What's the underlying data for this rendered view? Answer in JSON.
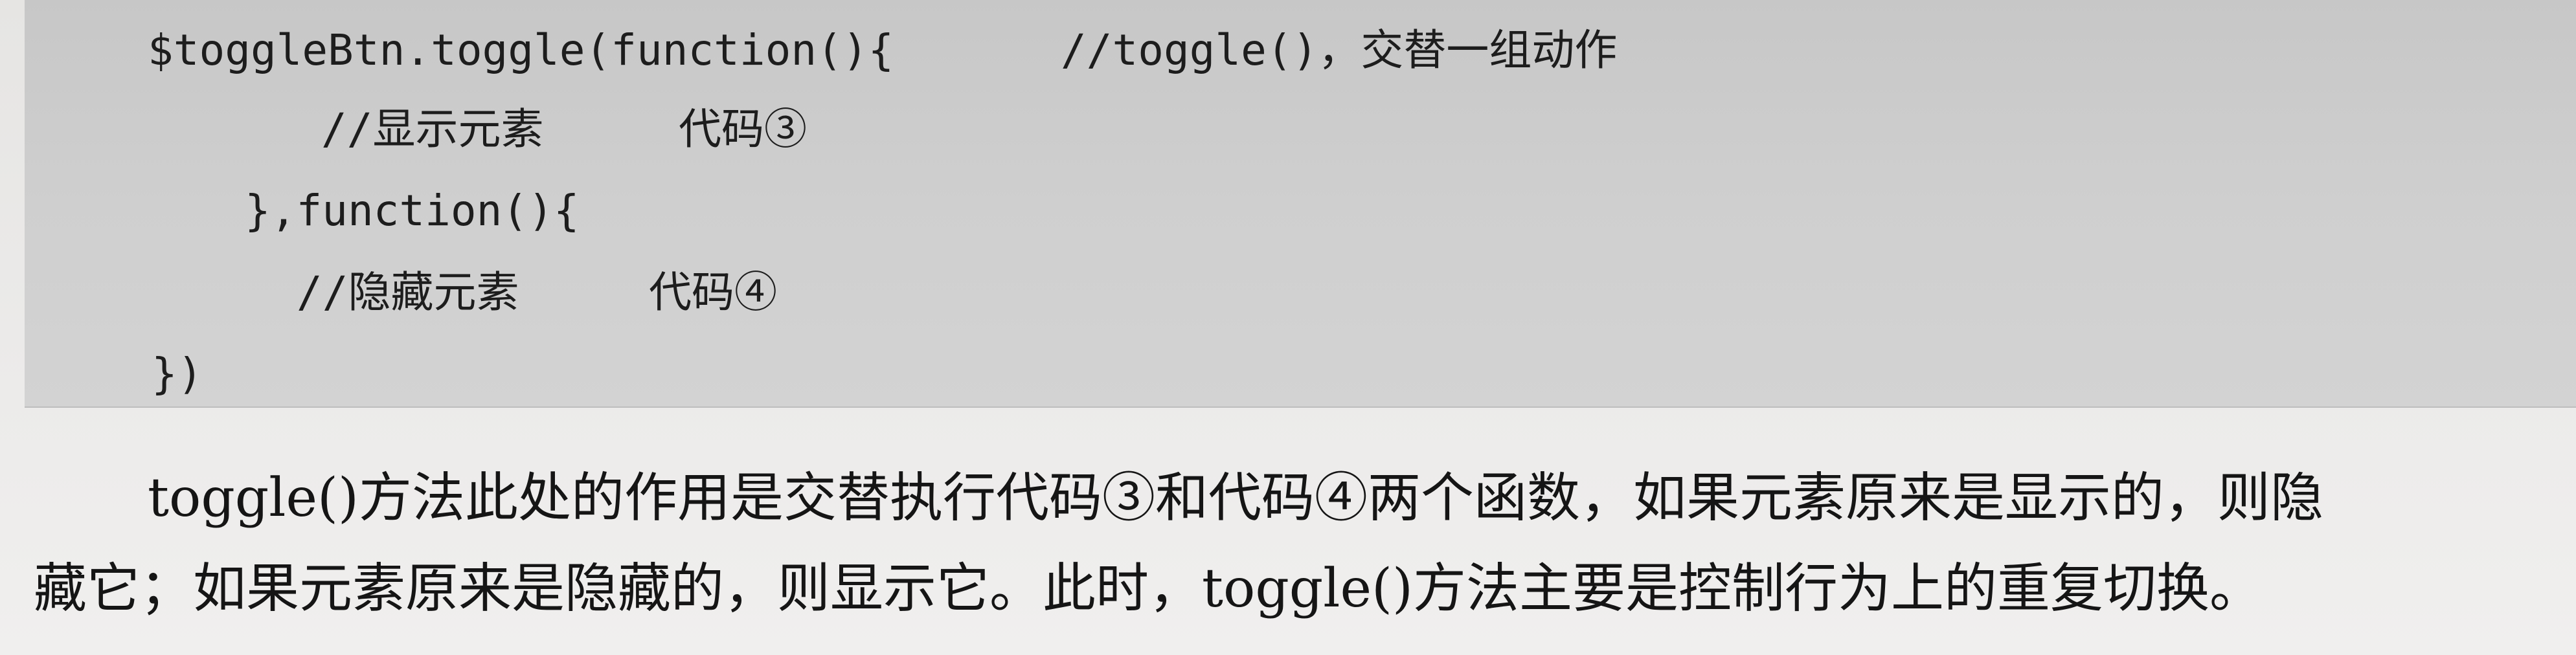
{
  "code": {
    "lines": [
      "$toggleBtn.toggle(function(){",
      "//toggle()，交替一组动作",
      "//显示元素",
      "代码③",
      "},function(){",
      "//隐藏元素",
      "代码④",
      "})"
    ]
  },
  "paragraph": {
    "line1": "toggle()方法此处的作用是交替执行代码③和代码④两个函数，如果元素原来是显示的，则隐",
    "line2": "藏它；如果元素原来是隐藏的，则显示它。此时，toggle()方法主要是控制行为上的重复切换。"
  }
}
